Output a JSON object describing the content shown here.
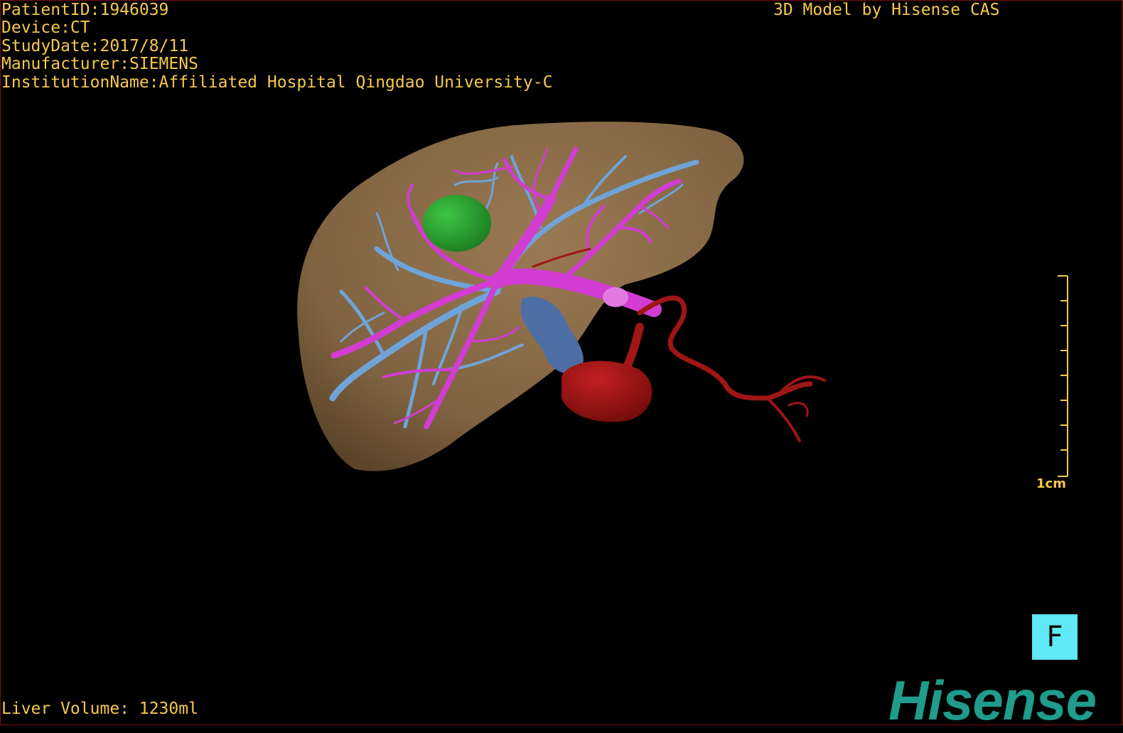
{
  "header": {
    "patient_id": "PatientID:1946039",
    "device": "Device:CT",
    "study_date": "StudyDate:2017/8/11",
    "manufacturer": "Manufacturer:SIEMENS",
    "institution": "InstitutionName:Affiliated Hospital Qingdao University-C",
    "credit": "3D Model by Hisense CAS"
  },
  "footer": {
    "liver_volume": "Liver Volume: 1230ml"
  },
  "scale_bar": {
    "label": "1cm"
  },
  "view_button": {
    "label": "F"
  },
  "logo": {
    "text": "Hisense"
  },
  "colors": {
    "overlay_text": "#f5c84c",
    "liver": "#8a6b45",
    "portal_vein": "#d23cd2",
    "hepatic_vein": "#6fa4d8",
    "tumor": "#2aa632",
    "artery": "#a01515",
    "view_button": "#5fe8f5",
    "logo": "#1f9c8b"
  },
  "icons": [
    "scale-bar-icon",
    "brand-logo-icon"
  ]
}
